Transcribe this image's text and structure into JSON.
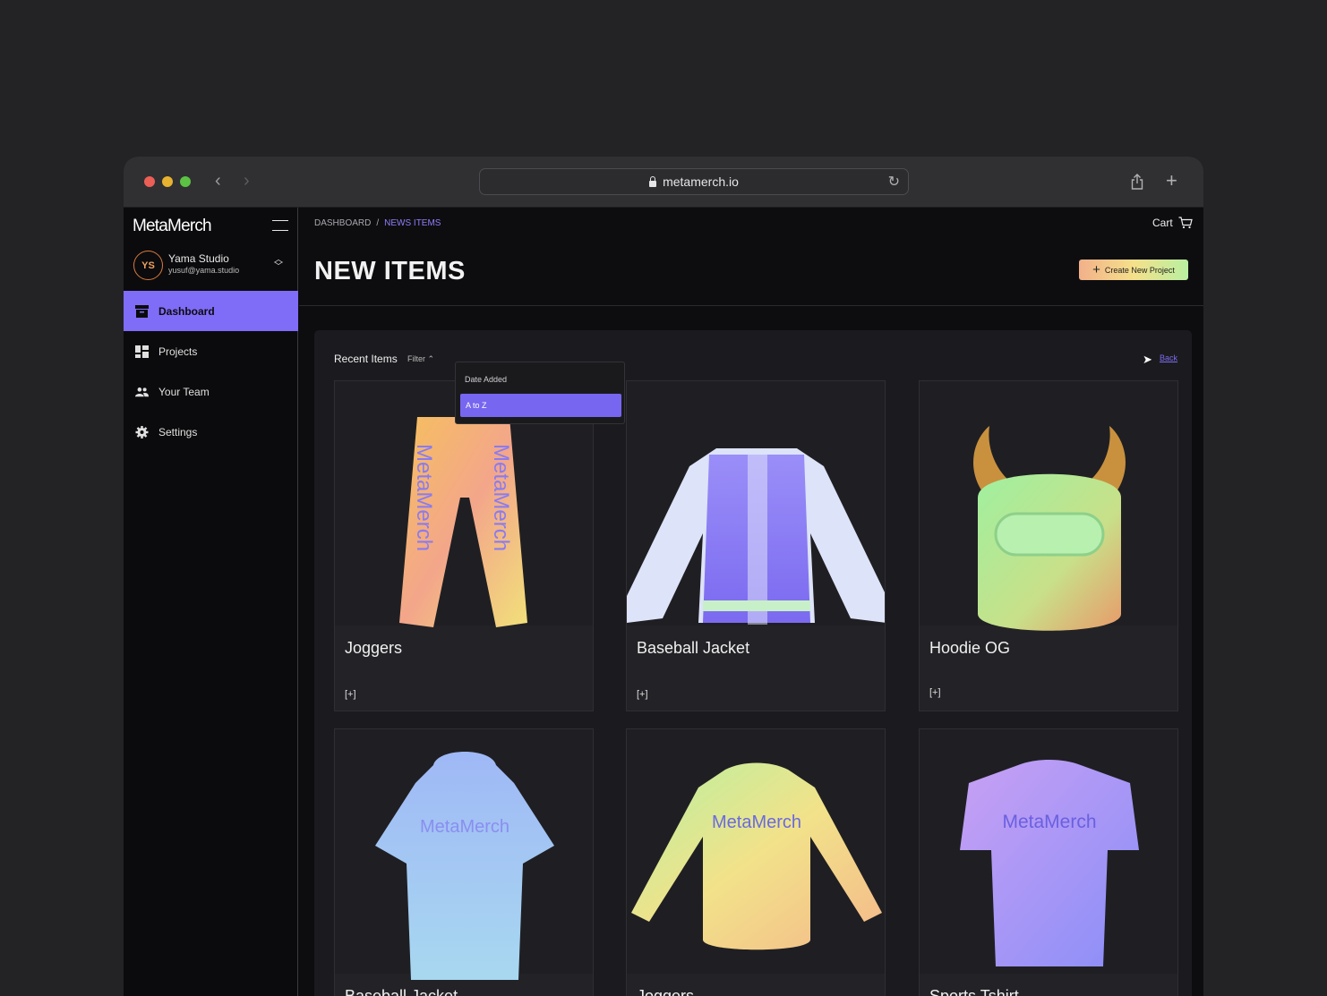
{
  "browser": {
    "url": "metamerch.io"
  },
  "sidebar": {
    "logo": "MetaMerch",
    "user": {
      "initials": "YS",
      "name": "Yama Studio",
      "email": "yusuf@yama.studio"
    },
    "items": [
      {
        "label": "Dashboard",
        "icon": "dashboard-icon"
      },
      {
        "label": "Projects",
        "icon": "projects-grid-icon"
      },
      {
        "label": "Your Team",
        "icon": "team-icon"
      },
      {
        "label": "Settings",
        "icon": "gear-icon"
      }
    ]
  },
  "header": {
    "breadcrumb": [
      "DASHBOARD",
      "/",
      "NEWS ITEMS"
    ],
    "cart_label": "Cart",
    "title": "NEW ITEMS",
    "create_label": "Create New Project"
  },
  "panel": {
    "recent_label": "Recent Items",
    "filter_label": "Filter",
    "back_label": "Back",
    "filter_options": [
      "Date Added",
      "A to Z"
    ],
    "selected_option": "A to Z",
    "cards": [
      {
        "name": "Joggers",
        "add": "[+]"
      },
      {
        "name": "Baseball Jacket",
        "add": "[+]"
      },
      {
        "name": "Hoodie OG",
        "add": "[+]"
      },
      {
        "name": "Baseball Jacket",
        "add": ""
      },
      {
        "name": "Joggers",
        "add": ""
      },
      {
        "name": "Sports Tshirt",
        "add": ""
      }
    ],
    "print_text": "MetaMerch"
  },
  "colors": {
    "accent": "#7f6cf7",
    "background": "#0d0d10"
  }
}
